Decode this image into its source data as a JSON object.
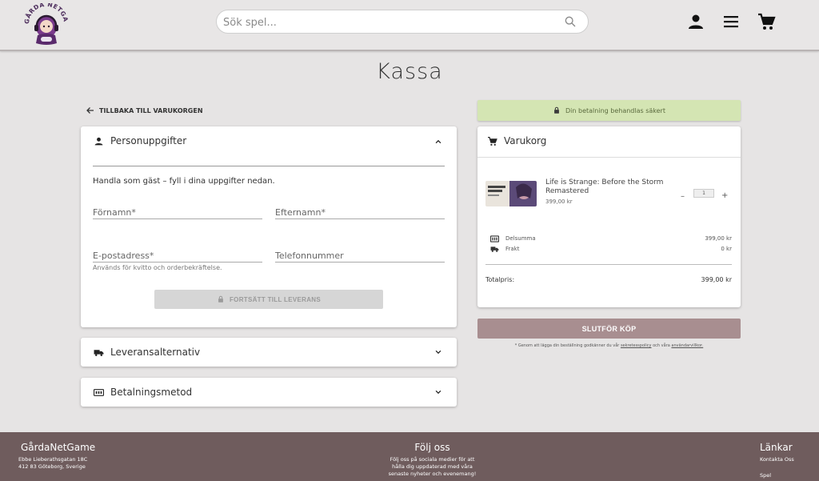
{
  "header": {
    "logo_text": "GÅRDA NETGAME",
    "search_placeholder": "Sök spel..."
  },
  "page": {
    "title": "Kassa",
    "back_label": "TILLBAKA TILL VARUKORGEN"
  },
  "personal": {
    "heading": "Personuppgifter",
    "intro": "Handla som gäst – fyll i dina uppgifter nedan.",
    "first_name_placeholder": "Förnamn*",
    "last_name_placeholder": "Efternamn*",
    "email_placeholder": "E-postadress*",
    "phone_placeholder": "Telefonnummer",
    "email_helper": "Används för kvitto och orderbekräftelse.",
    "continue_label": "FORTSÄTT TILL LEVERANS"
  },
  "delivery": {
    "heading": "Leveransalternativ"
  },
  "payment": {
    "heading": "Betalningsmetod"
  },
  "cart": {
    "secure_text": "Din betalning behandlas säkert",
    "heading": "Varukorg",
    "item": {
      "title": "Life is Strange: Before the Storm Remastered",
      "price": "399,00 kr",
      "quantity": "1",
      "minus": "–",
      "plus": "+"
    },
    "subtotal_label": "Delsumma",
    "subtotal_value": "399,00 kr",
    "shipping_label": "Frakt",
    "shipping_value": "0 kr",
    "total_label": "Totalpris:",
    "total_value": "399,00 kr",
    "buy_label": "SLUTFÖR KÖP",
    "terms_prefix": "* Genom att lägga din beställning godkänner du vår",
    "privacy_link": "sekretesspolicy",
    "terms_mid": "och våra",
    "terms_link": "användarvillkor."
  },
  "footer": {
    "brand": "GårdaNetGame",
    "address_line1": "Ebbe Lieberathsgatan 18C",
    "address_line2": "412 83 Göteborg, Sverige",
    "follow_title": "Följ oss",
    "follow_text1": "Följ oss på sociala medier för att",
    "follow_text2": "hålla dig uppdaterad med våra",
    "follow_text3": "senaste nyheter och evenemang!",
    "links_title": "Länkar",
    "link_contact": "Kontakta Oss",
    "link_games": "Spel"
  },
  "colors": {
    "accent_buy": "#a88e90",
    "secure_bg": "#d4e5b3",
    "footer_bg": "#6f5c5d"
  }
}
